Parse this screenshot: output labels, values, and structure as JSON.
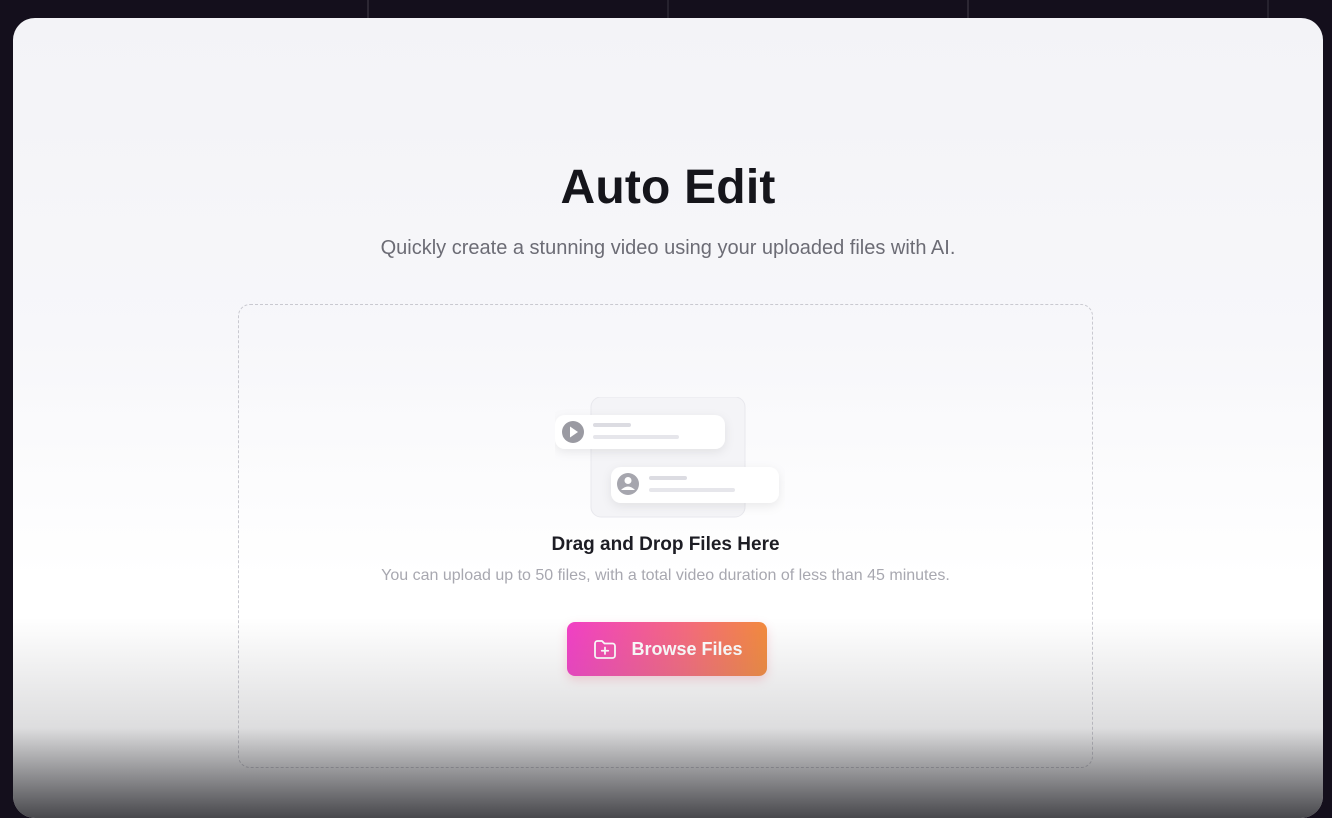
{
  "dialog": {
    "title": "Auto Edit",
    "subtitle": "Quickly create a stunning video using your uploaded files with AI."
  },
  "dropzone": {
    "title": "Drag and Drop Files Here",
    "hint": "You can upload up to 50 files, with a total video duration of less than 45 minutes.",
    "illustration_icons": [
      "play-icon",
      "image-icon"
    ],
    "browse_button": {
      "label": "Browse Files",
      "icon": "folder-plus-icon"
    }
  },
  "colors": {
    "button_gradient_start": "#f23fc6",
    "button_gradient_end": "#f38a3c",
    "title": "#15151b",
    "subtitle": "#6c6c75"
  }
}
